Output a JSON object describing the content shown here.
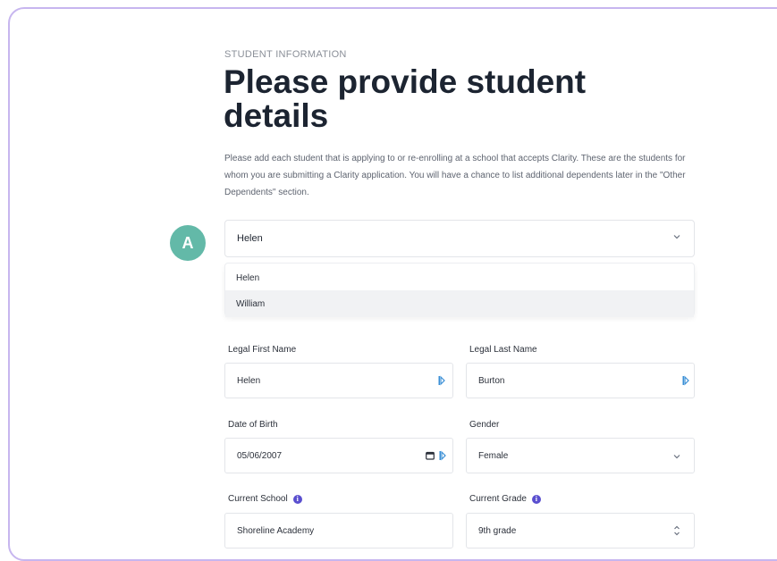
{
  "header": {
    "overline": "STUDENT INFORMATION",
    "title": "Please provide student details",
    "description": "Please add each student that is applying to or re-enrolling at a school that accepts Clarity. These are the students for whom you are submitting a Clarity application. You will have a chance to list additional dependents later in the \"Other Dependents\" section."
  },
  "badge": "A",
  "student_select": {
    "value": "Helen",
    "options": [
      "Helen",
      "William"
    ]
  },
  "form": {
    "first_name": {
      "label": "Legal First Name",
      "value": "Helen"
    },
    "last_name": {
      "label": "Legal Last Name",
      "value": "Burton"
    },
    "dob": {
      "label": "Date of Birth",
      "value": "05/06/2007"
    },
    "gender": {
      "label": "Gender",
      "value": "Female"
    },
    "school": {
      "label": "Current School",
      "value": "Shoreline Academy"
    },
    "grade": {
      "label": "Current Grade",
      "value": "9th grade"
    }
  },
  "icons": {
    "info": "i",
    "accent": "#5a4fcf",
    "badge_color": "#63b9a8",
    "autofill_color": "#3a8fd6"
  }
}
